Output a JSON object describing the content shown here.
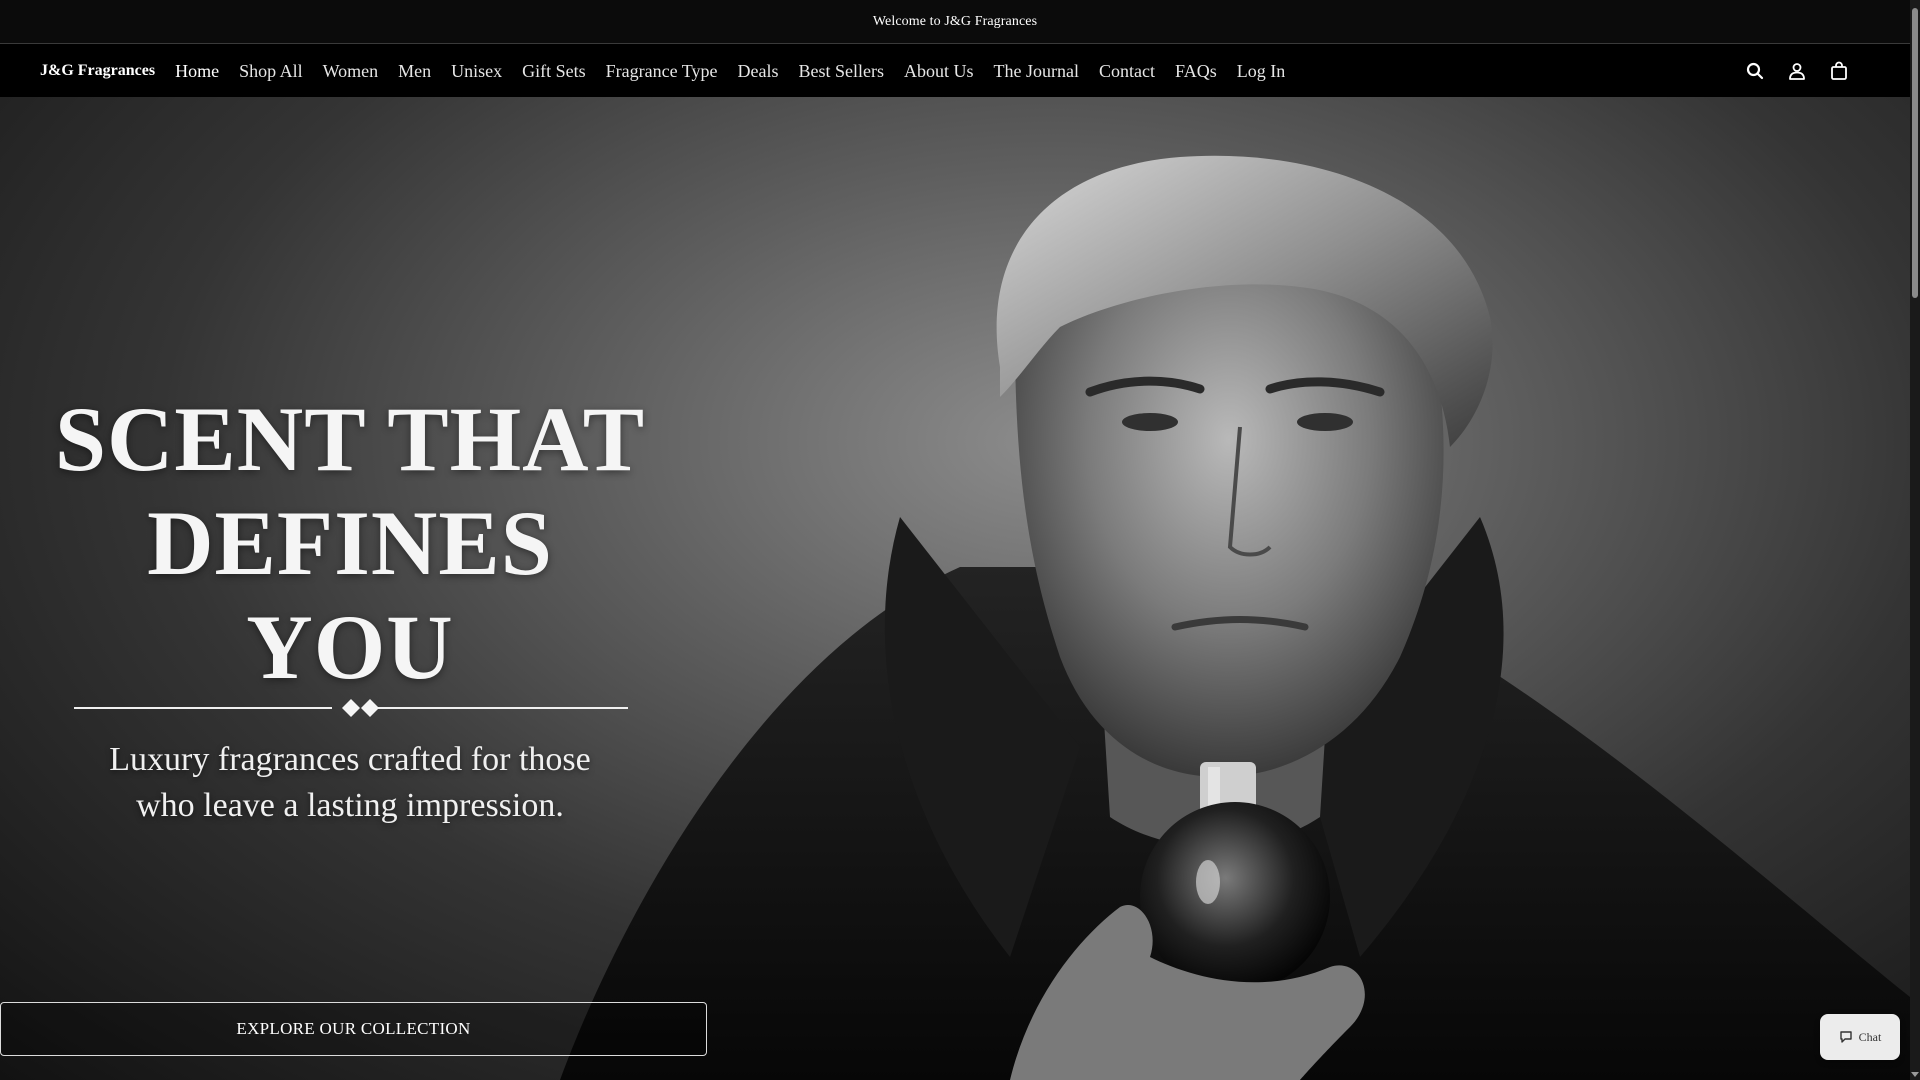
{
  "announcement": {
    "text": "Welcome to J&G Fragrances"
  },
  "header": {
    "brand": "J&G Fragrances",
    "nav": [
      {
        "label": "Home",
        "active": true
      },
      {
        "label": "Shop All"
      },
      {
        "label": "Women"
      },
      {
        "label": "Men"
      },
      {
        "label": "Unisex"
      },
      {
        "label": "Gift Sets"
      },
      {
        "label": "Fragrance Type"
      },
      {
        "label": "Deals"
      },
      {
        "label": "Best Sellers"
      },
      {
        "label": "About Us"
      },
      {
        "label": "The Journal"
      },
      {
        "label": "Contact"
      },
      {
        "label": "FAQs"
      },
      {
        "label": "Log In"
      }
    ],
    "icons": [
      "search-icon",
      "account-icon",
      "cart-icon"
    ]
  },
  "hero": {
    "headline_line1": "SCENT THAT",
    "headline_line2": "DEFINES YOU",
    "subhead_line1": "Luxury fragrances crafted for those",
    "subhead_line2": "who leave a lasting impression.",
    "cta_label": "EXPLORE OUR COLLECTION"
  },
  "chat": {
    "label": "Chat",
    "icon": "chat-bubble-icon"
  }
}
